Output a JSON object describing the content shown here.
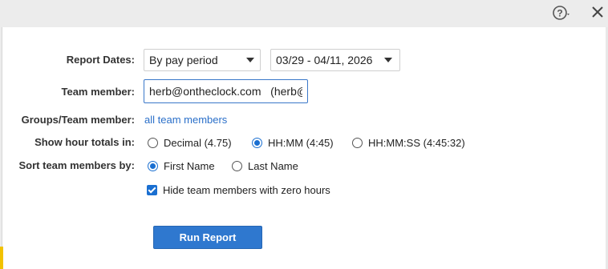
{
  "toolbar": {
    "help_icon": "help-circle-icon",
    "close_icon": "close-icon"
  },
  "form": {
    "report_dates_label": "Report Dates:",
    "period_select_value": "By pay period",
    "date_range_value": "03/29 - 04/11, 2026",
    "team_member_label": "Team member:",
    "team_member_value": "herb@ontheclock.com   (herb@",
    "groups_label": "Groups/Team member:",
    "groups_link": "all team members",
    "hour_totals_label": "Show hour totals in:",
    "hour_options": [
      "Decimal (4.75)",
      "HH:MM (4:45)",
      "HH:MM:SS (4:45:32)"
    ],
    "hour_selected": "HH:MM (4:45)",
    "sort_label": "Sort team members by:",
    "sort_options": [
      "First Name",
      "Last Name"
    ],
    "sort_selected": "First Name",
    "hide_zero_label": "Hide team members with zero hours",
    "hide_zero_checked": true,
    "run_button": "Run Report"
  },
  "colors": {
    "accent": "#2f78cf",
    "link": "#2a6fc9"
  }
}
